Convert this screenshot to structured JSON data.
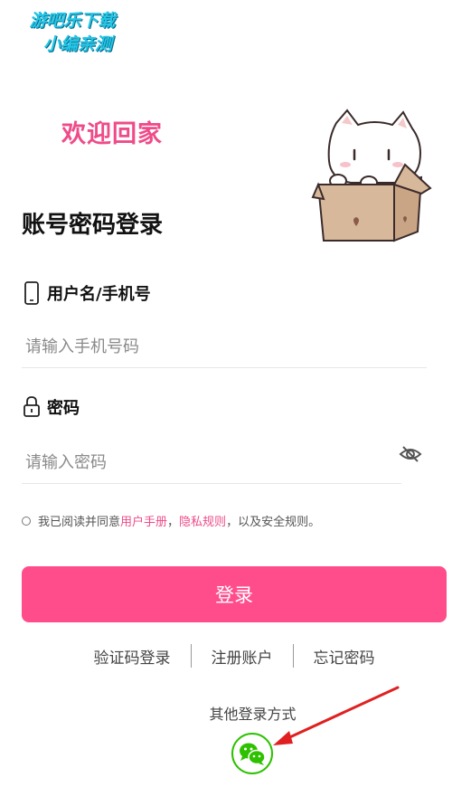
{
  "watermark": {
    "line1": "游吧乐下载",
    "line2": "小编亲测"
  },
  "header": {
    "welcome": "欢迎回家",
    "title": "账号密码登录"
  },
  "username": {
    "label": "用户名/手机号",
    "placeholder": "请输入手机号码"
  },
  "password": {
    "label": "密码",
    "placeholder": "请输入密码"
  },
  "agreement": {
    "prefix": "我已阅读并同意",
    "link1": "用户手册",
    "sep": "，",
    "link2": "隐私规则",
    "suffix": "，以及安全规则。"
  },
  "login_button": "登录",
  "links": {
    "sms_login": "验证码登录",
    "register": "注册账户",
    "forgot": "忘记密码"
  },
  "other_login": {
    "title": "其他登录方式",
    "icon": "wechat-icon"
  },
  "colors": {
    "accent": "#ff4d8b",
    "wechat": "#2dc100",
    "annotation": "#e02020"
  }
}
